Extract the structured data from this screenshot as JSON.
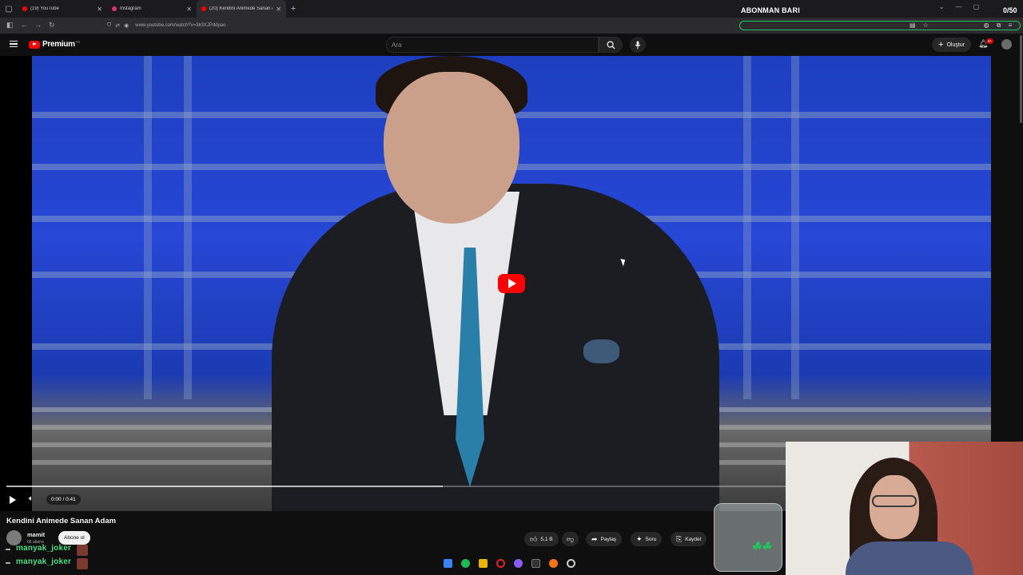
{
  "browser": {
    "tabs": [
      {
        "label": "(19) YouTube",
        "favicon_color": "#ff0000",
        "active": false
      },
      {
        "label": "Instagram",
        "favicon_color": "#e1306c",
        "active": false
      },
      {
        "label": "(20) Kendini Animede Sanan Ad",
        "favicon_color": "#ff0000",
        "active": true
      }
    ],
    "url": "www.youtube.com/watch?v=3k3XJPddpao"
  },
  "overlay": {
    "title": "ABONMAN BARI",
    "count": "0/50",
    "accent": "#22c55e"
  },
  "youtube": {
    "logo": "Premium",
    "logo_sup": "TR",
    "search_placeholder": "Ara",
    "create_label": "Oluştur",
    "notification_badge": "9+"
  },
  "player": {
    "time": "0:00 / 0:41",
    "buffered_fraction": 0.56
  },
  "video": {
    "title": "Kendini Animede Sanan Adam",
    "channel": "mamit",
    "subscribers": "66 abone",
    "subscribe_label": "Abone ol",
    "likes": "5,1 B",
    "share_label": "Paylaş",
    "ask_label": "Soru",
    "save_label": "Kaydet"
  },
  "chat": [
    {
      "user": "manyak_joker"
    },
    {
      "user": "manyak_joker"
    }
  ],
  "taskbar": [
    "windows-icon",
    "spotify-icon",
    "folder-icon",
    "opera-icon",
    "discord-icon",
    "terminal-icon",
    "firefox-icon",
    "obs-icon"
  ]
}
